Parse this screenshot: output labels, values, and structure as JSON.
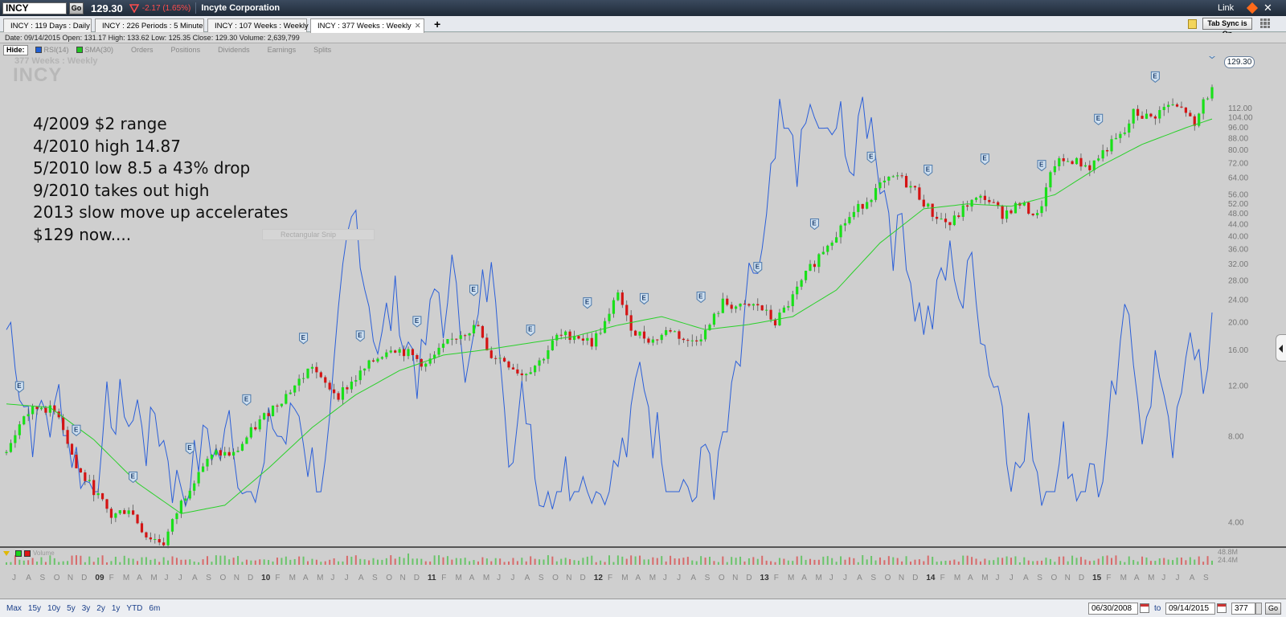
{
  "topbar": {
    "symbol": "INCY",
    "go_label": "Go",
    "price": "129.30",
    "change": "-2.17 (1.65%)",
    "company": "Incyte Corporation",
    "link_label": "Link",
    "close_glyph": "✕"
  },
  "tabs": [
    {
      "label": "INCY : 119  Days : Daily"
    },
    {
      "label": "INCY : 226  Periods : 5 Minute"
    },
    {
      "label": "INCY : 107  Weeks : Weekly"
    },
    {
      "label": "INCY : 377  Weeks : Weekly",
      "active": true
    }
  ],
  "tab_close_glyph": "✕",
  "tab_add_glyph": "+",
  "tab_sync_label": "Tab Sync is On",
  "info": "Date: 09/14/2015   Open: 131.17   High: 133.62   Low: 125.35   Close: 129.30   Volume: 2,639,799",
  "hidebar": {
    "hide_label": "Hide:",
    "indicators": [
      {
        "label": "RSI(14)",
        "color": "#1f5fd6"
      },
      {
        "label": "SMA(30)",
        "color": "#21c521"
      }
    ],
    "toggles": [
      "Orders",
      "Positions",
      "Dividends",
      "Earnings",
      "Splits"
    ]
  },
  "watermark": {
    "sub": "377  Weeks : Weekly",
    "symbol": "INCY"
  },
  "notes": [
    "4/2009 $2 range",
    "4/2010 high 14.87",
    "5/2010 low 8.5 a 43% drop",
    "9/2010 takes out high",
    "2013 slow move up accelerates",
    "$129 now...."
  ],
  "snip_label": "Rectangular Snip",
  "last_price_tag": "129.30",
  "chart_data": {
    "type": "candlestick",
    "y_scale": "log",
    "ylim": [
      3.2,
      150
    ],
    "y_ticks": [
      "112.00",
      "104.00",
      "96.00",
      "88.00",
      "80.00",
      "72.00",
      "64.00",
      "56.00",
      "52.00",
      "48.00",
      "44.00",
      "40.00",
      "36.00",
      "32.00",
      "28.00",
      "24.00",
      "20.00",
      "16.00",
      "12.00",
      "8.00",
      "4.00"
    ],
    "x_ticks": [
      "J",
      "A",
      "S",
      "O",
      "N",
      "D",
      "09",
      "F",
      "M",
      "A",
      "M",
      "J",
      "J",
      "A",
      "S",
      "O",
      "N",
      "D",
      "10",
      "F",
      "M",
      "A",
      "M",
      "J",
      "J",
      "A",
      "S",
      "O",
      "N",
      "D",
      "11",
      "F",
      "M",
      "A",
      "M",
      "J",
      "J",
      "A",
      "S",
      "O",
      "N",
      "D",
      "12",
      "F",
      "M",
      "A",
      "M",
      "J",
      "J",
      "A",
      "S",
      "O",
      "N",
      "D",
      "13",
      "F",
      "M",
      "A",
      "M",
      "J",
      "J",
      "A",
      "S",
      "O",
      "N",
      "D",
      "14",
      "F",
      "M",
      "A",
      "M",
      "J",
      "J",
      "A",
      "S",
      "O",
      "N",
      "D",
      "15",
      "F",
      "M",
      "A",
      "M",
      "J",
      "J",
      "A",
      "S"
    ],
    "series": [
      {
        "name": "SMA(30)",
        "color": "#2ad02a"
      },
      {
        "name": "RSI(14)",
        "color": "#2b5fd9"
      }
    ],
    "close_path": [
      [
        0,
        7.0
      ],
      [
        4,
        9.5
      ],
      [
        8,
        10.2
      ],
      [
        12,
        9.6
      ],
      [
        16,
        6.2
      ],
      [
        20,
        5.2
      ],
      [
        24,
        4.2
      ],
      [
        28,
        4.5
      ],
      [
        32,
        3.6
      ],
      [
        36,
        3.4
      ],
      [
        40,
        4.7
      ],
      [
        44,
        6.1
      ],
      [
        48,
        7.0
      ],
      [
        52,
        6.9
      ],
      [
        56,
        8.3
      ],
      [
        60,
        9.8
      ],
      [
        64,
        11.2
      ],
      [
        68,
        13.0
      ],
      [
        70,
        14.2
      ],
      [
        72,
        12.5
      ],
      [
        76,
        11.2
      ],
      [
        80,
        12.8
      ],
      [
        84,
        14.7
      ],
      [
        88,
        16.5
      ],
      [
        92,
        15.6
      ],
      [
        96,
        14.2
      ],
      [
        100,
        16.4
      ],
      [
        104,
        18.4
      ],
      [
        108,
        19.4
      ],
      [
        110,
        15.6
      ],
      [
        114,
        14.8
      ],
      [
        118,
        13.2
      ],
      [
        122,
        14.6
      ],
      [
        126,
        17.8
      ],
      [
        130,
        18.2
      ],
      [
        134,
        17.0
      ],
      [
        138,
        21.0
      ],
      [
        140,
        26.0
      ],
      [
        142,
        20.5
      ],
      [
        144,
        18.5
      ],
      [
        148,
        17.3
      ],
      [
        152,
        19.0
      ],
      [
        156,
        17.0
      ],
      [
        160,
        18.5
      ],
      [
        164,
        23.5
      ],
      [
        168,
        22.5
      ],
      [
        172,
        23.0
      ],
      [
        176,
        20.0
      ],
      [
        180,
        24.5
      ],
      [
        184,
        31.0
      ],
      [
        188,
        38.0
      ],
      [
        192,
        45.0
      ],
      [
        196,
        52.0
      ],
      [
        200,
        60.0
      ],
      [
        204,
        65.0
      ],
      [
        208,
        58.0
      ],
      [
        212,
        48.0
      ],
      [
        216,
        44.0
      ],
      [
        220,
        52.0
      ],
      [
        224,
        55.0
      ],
      [
        228,
        48.0
      ],
      [
        232,
        52.0
      ],
      [
        236,
        47.0
      ],
      [
        240,
        72.0
      ],
      [
        244,
        74.0
      ],
      [
        248,
        70.0
      ],
      [
        252,
        82.0
      ],
      [
        256,
        92.0
      ],
      [
        258,
        108.0
      ],
      [
        262,
        104.0
      ],
      [
        266,
        115.0
      ],
      [
        270,
        110.0
      ],
      [
        272,
        95.0
      ],
      [
        274,
        120.0
      ],
      [
        276,
        129.3
      ]
    ],
    "sma_path": [
      [
        0,
        10.4
      ],
      [
        10,
        10.1
      ],
      [
        20,
        7.8
      ],
      [
        30,
        5.5
      ],
      [
        40,
        4.3
      ],
      [
        50,
        4.6
      ],
      [
        60,
        6.2
      ],
      [
        70,
        8.6
      ],
      [
        80,
        11.2
      ],
      [
        90,
        13.6
      ],
      [
        100,
        15.4
      ],
      [
        110,
        16.1
      ],
      [
        120,
        17.0
      ],
      [
        130,
        17.9
      ],
      [
        140,
        19.6
      ],
      [
        150,
        21.0
      ],
      [
        160,
        18.9
      ],
      [
        170,
        19.7
      ],
      [
        180,
        21.0
      ],
      [
        190,
        26.0
      ],
      [
        200,
        38.0
      ],
      [
        210,
        50.0
      ],
      [
        220,
        52.0
      ],
      [
        230,
        51.0
      ],
      [
        240,
        56.0
      ],
      [
        250,
        70.0
      ],
      [
        260,
        84.0
      ],
      [
        270,
        96.0
      ],
      [
        276,
        103.0
      ]
    ],
    "earnings_markers": "E",
    "volume_scale": [
      "48.8M",
      "24.4M"
    ]
  },
  "volume_legend": "Volume",
  "bottom": {
    "ranges": [
      "Max",
      "15y",
      "10y",
      "5y",
      "3y",
      "2y",
      "1y",
      "YTD",
      "6m"
    ],
    "from_date": "06/30/2008",
    "to_label": "to",
    "to_date": "09/14/2015",
    "bars": "377",
    "go_label": "Go"
  }
}
